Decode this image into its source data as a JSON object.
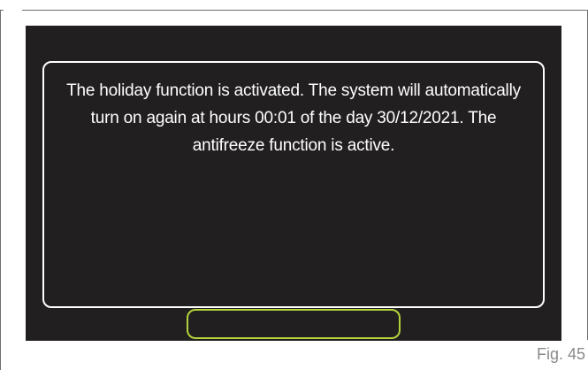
{
  "dialog": {
    "message": "The holiday function is activated. The system will automatically turn on again at hours 00:01 of the day 30/12/2021. The antifreeze function is active."
  },
  "figure": {
    "label": "Fig. 45"
  },
  "colors": {
    "screen_background": "#221f20",
    "dialog_border": "#ffffff",
    "button_border": "#b3d33b",
    "text": "#ffffff",
    "figure_label": "#8a8a8a",
    "frame": "#6f6f6f"
  }
}
